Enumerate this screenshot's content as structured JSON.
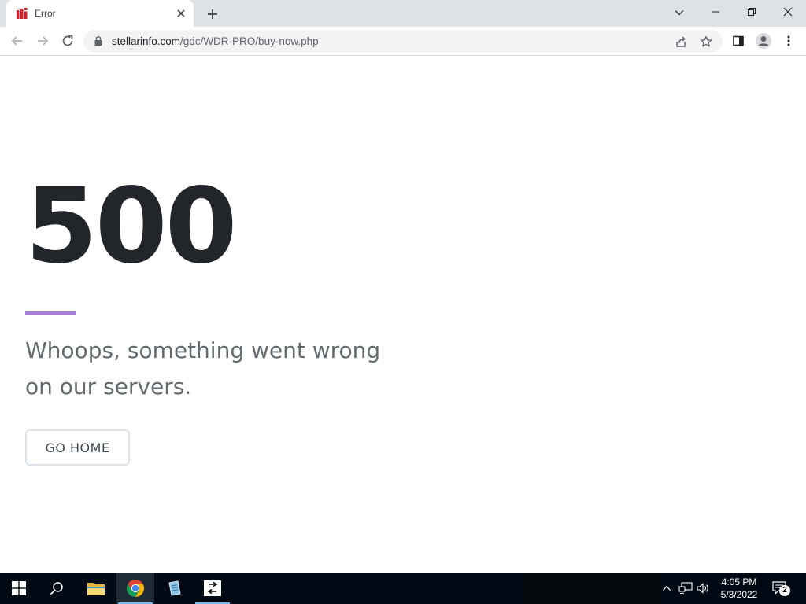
{
  "browser": {
    "tab_title": "Error",
    "url_host": "stellarinfo.com",
    "url_path": "/gdc/WDR-PRO/buy-now.php"
  },
  "page": {
    "code": "500",
    "message": "Whoops, something went wrong on our servers.",
    "button_label": "GO HOME",
    "accent_color": "#a77fd6"
  },
  "taskbar": {
    "time": "4:05 PM",
    "date": "5/3/2022",
    "notification_count": "2"
  }
}
